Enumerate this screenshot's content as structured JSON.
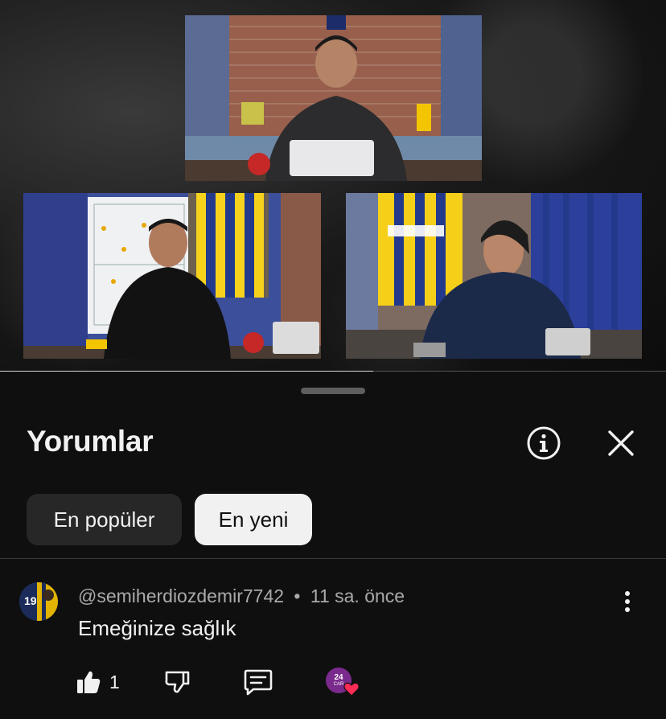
{
  "video": {
    "progress": 0.56
  },
  "sheet": {
    "title": "Yorumlar",
    "info_icon": "info-icon",
    "close_icon": "close-icon"
  },
  "sort_chips": [
    {
      "label": "En popüler",
      "selected": false
    },
    {
      "label": "En yeni",
      "selected": true
    }
  ],
  "comment": {
    "author": "@semiherdiozdemir7742",
    "separator": "•",
    "time": "11 sa. önce",
    "text": "Emeğinize sağlık",
    "like_count": "1",
    "badge_text": "24",
    "badge_subtext": "CAR"
  },
  "colors": {
    "background": "#0f0f0f",
    "chip_inactive": "#272727",
    "chip_active": "#f1f1f1",
    "meta_text": "#aaaaaa",
    "heart": "#ff2d55"
  }
}
